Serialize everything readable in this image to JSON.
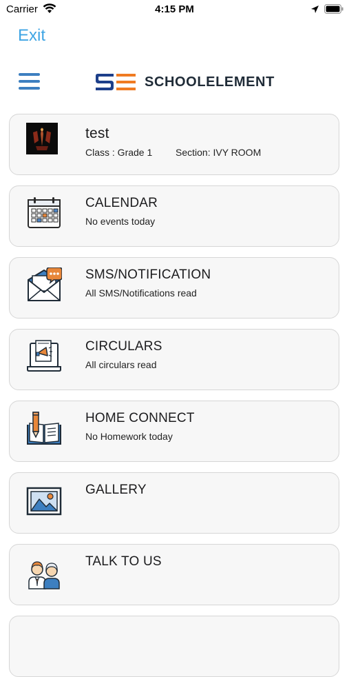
{
  "status_bar": {
    "carrier": "Carrier",
    "time": "4:15 PM"
  },
  "header": {
    "exit_label": "Exit",
    "logo_text": "SCHOOLELEMENT",
    "logo_mark": "SE"
  },
  "profile": {
    "name": "test",
    "class_text": "Class : Grade 1",
    "section_text": "Section: IVY ROOM"
  },
  "menu_items": [
    {
      "title": "CALENDAR",
      "subtitle": "No events today",
      "icon": "calendar-icon"
    },
    {
      "title": "SMS/NOTIFICATION",
      "subtitle": "All SMS/Notifications read",
      "icon": "envelope-chat-icon"
    },
    {
      "title": "CIRCULARS",
      "subtitle": "All circulars read",
      "icon": "megaphone-laptop-icon"
    },
    {
      "title": "HOME CONNECT",
      "subtitle": "No Homework today",
      "icon": "book-pencil-icon"
    },
    {
      "title": "GALLERY",
      "subtitle": "",
      "icon": "picture-icon"
    },
    {
      "title": "TALK TO US",
      "subtitle": "",
      "icon": "people-icon"
    }
  ],
  "colors": {
    "accent_blue": "#3d7fc0",
    "exit_blue": "#3fa5e4",
    "logo_orange": "#f07b22",
    "logo_navy": "#1d3f8a",
    "card_bg": "#f7f7f7",
    "card_border": "#d6d6d6"
  }
}
